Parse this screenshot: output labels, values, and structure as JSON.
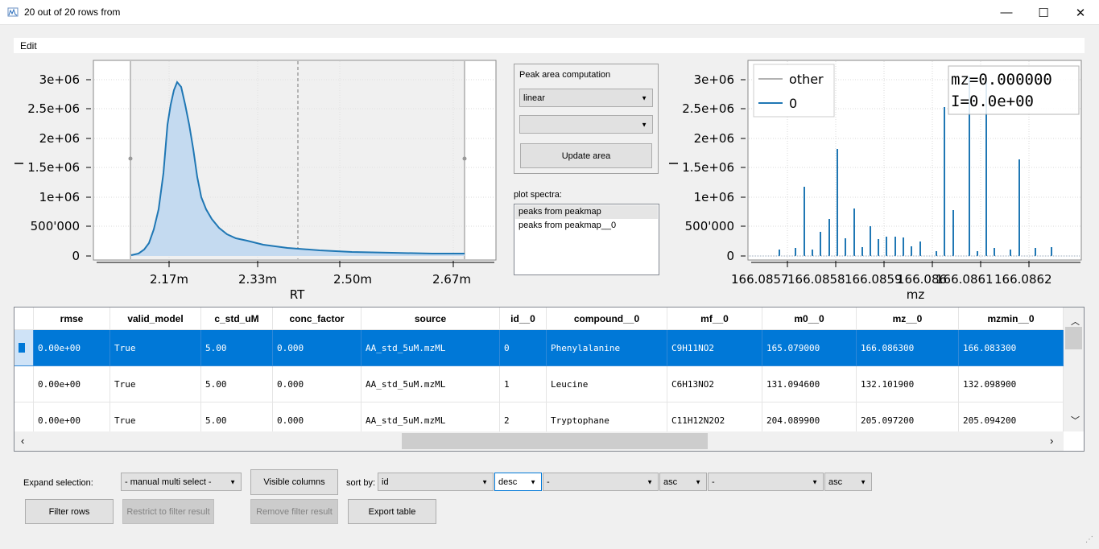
{
  "window": {
    "title": "20 out of 20 rows from",
    "min": "—",
    "max": "☐",
    "close": "✕"
  },
  "menu": {
    "edit": "Edit"
  },
  "rt_plot": {
    "xlabel": "RT",
    "ylabel": "I",
    "xticks": [
      "2.17m",
      "2.33m",
      "2.50m",
      "2.67m"
    ],
    "yticks": [
      "0",
      "500'000",
      "1e+06",
      "1.5e+06",
      "2e+06",
      "2.5e+06",
      "3e+06"
    ]
  },
  "peak_area": {
    "title": "Peak area computation",
    "method_value": "linear",
    "second_value": "",
    "update_label": "Update area"
  },
  "plot_spectra": {
    "label": "plot spectra:",
    "items": [
      "peaks from peakmap",
      "peaks from peakmap__0"
    ]
  },
  "mz_plot": {
    "xlabel": "mz",
    "ylabel": "I",
    "xticks": [
      "166.0857",
      "166.0858",
      "166.0859",
      "166.086",
      "166.0861",
      "166.0862"
    ],
    "yticks": [
      "0",
      "500'000",
      "1e+06",
      "1.5e+06",
      "2e+06",
      "2.5e+06",
      "3e+06"
    ],
    "legend": [
      "other",
      "0"
    ],
    "readout_mz": "mz=0.000000",
    "readout_i": "I=0.0e+00"
  },
  "table": {
    "headers": [
      "rmse",
      "valid_model",
      "c_std_uM",
      "conc_factor",
      "source",
      "id__0",
      "compound__0",
      "mf__0",
      "m0__0",
      "mz__0",
      "mzmin__0"
    ],
    "rows": [
      [
        "0.00e+00",
        "True",
        "5.00",
        "0.000",
        "AA_std_5uM.mzML",
        "0",
        "Phenylalanine",
        "C9H11NO2",
        "165.079000",
        "166.086300",
        "166.083300"
      ],
      [
        "0.00e+00",
        "True",
        "5.00",
        "0.000",
        "AA_std_5uM.mzML",
        "1",
        "Leucine",
        "C6H13NO2",
        "131.094600",
        "132.101900",
        "132.098900"
      ],
      [
        "0.00e+00",
        "True",
        "5.00",
        "0.000",
        "AA_std_5uM.mzML",
        "2",
        "Tryptophane",
        "C11H12N2O2",
        "204.089900",
        "205.097200",
        "205.094200"
      ]
    ]
  },
  "controls": {
    "expand_label": "Expand selection:",
    "expand_value": "- manual multi select -",
    "visible_columns": "Visible columns",
    "sort_by": "sort by:",
    "sort1_field": "id",
    "sort1_order": "desc",
    "sort2_field": "-",
    "sort2_order": "asc",
    "sort3_field": "-",
    "sort3_order": "asc",
    "filter_rows": "Filter rows",
    "restrict": "Restrict to filter result",
    "remove": "Remove filter result",
    "export": "Export table"
  }
}
